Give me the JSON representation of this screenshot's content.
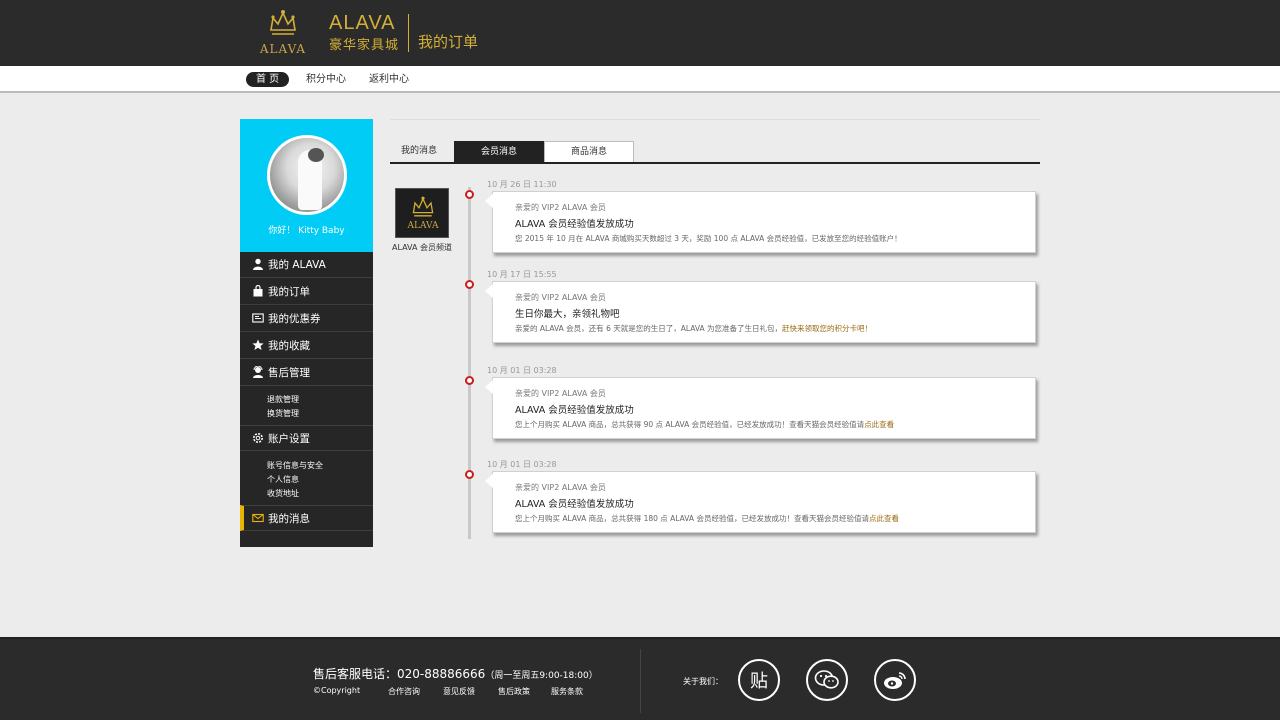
{
  "header": {
    "brand_emblem_text": "ALAVA",
    "brand_name": "ALAVA",
    "brand_subtitle": "豪华家具城",
    "page_heading": "我的订单"
  },
  "nav": {
    "items": [
      {
        "label": "首 页",
        "active": true
      },
      {
        "label": "积分中心",
        "active": false
      },
      {
        "label": "返利中心",
        "active": false
      }
    ]
  },
  "sidebar": {
    "greeting": "你好！ Kitty Baby",
    "menu": [
      {
        "icon": "user-icon",
        "label": "我的 ALAVA"
      },
      {
        "icon": "bag-icon",
        "label": "我的订单"
      },
      {
        "icon": "coupon-icon",
        "label": "我的优惠券"
      },
      {
        "icon": "star-icon",
        "label": "我的收藏"
      },
      {
        "icon": "service-icon",
        "label": "售后管理"
      },
      {
        "icon": "gear-icon",
        "label": "账户设置"
      },
      {
        "icon": "mail-icon",
        "label": "我的消息"
      }
    ],
    "after_sales_sub": [
      "退款管理",
      "换货管理"
    ],
    "account_sub": [
      "账号信息与安全",
      "个人信息",
      "收货地址"
    ]
  },
  "tabs": [
    {
      "label": "我的消息",
      "state": "plain"
    },
    {
      "label": "会员消息",
      "state": "active"
    },
    {
      "label": "商品消息",
      "state": "boxed"
    }
  ],
  "sender": {
    "logo_text": "ALAVA",
    "name": "ALAVA 会员频道"
  },
  "messages": [
    {
      "time": "10 月 26 日 11:30",
      "from": "亲爱的 VIP2 ALAVA 会员",
      "title": "ALAVA 会员经验值发放成功",
      "body": "您 2015 年 10 月在 ALAVA 商城购买天数超过 3 天，奖励 100 点 ALAVA 会员经验值，已发放至您的经验值账户！",
      "link": ""
    },
    {
      "time": "10 月 17 日 15:55",
      "from": "亲爱的 VIP2 ALAVA 会员",
      "title": "生日你最大，亲领礼物吧",
      "body": "亲爱的 ALAVA 会员，还有 6 天就是您的生日了，ALAVA 为您准备了生日礼包，",
      "link": "赶快来领取您的积分卡吧！"
    },
    {
      "time": "10 月 01 日 03:28",
      "from": "亲爱的 VIP2 ALAVA 会员",
      "title": "ALAVA 会员经验值发放成功",
      "body": "您上个月购买 ALAVA 商品，总共获得 90 点 ALAVA 会员经验值，已经发放成功！查看天猫会员经验值请",
      "link": "点此查看"
    },
    {
      "time": "10 月 01 日 03:28",
      "from": "亲爱的 VIP2 ALAVA 会员",
      "title": "ALAVA 会员经验值发放成功",
      "body": "您上个月购买 ALAVA 商品，总共获得 180 点 ALAVA 会员经验值，已经发放成功！查看天猫会员经验值请",
      "link": "点此查看"
    }
  ],
  "footer": {
    "hotline_label": "售后客服电话：020-88886666",
    "hotline_hours": "（周一至周五9:00-18:00）",
    "links": [
      "©Copyright",
      "合作咨询",
      "意见反馈",
      "售后政策",
      "服务条款"
    ],
    "follow_label": "关于我们：",
    "social": [
      {
        "icon": "tieba-icon",
        "glyph": "贴"
      },
      {
        "icon": "wechat-icon",
        "glyph": "◌"
      },
      {
        "icon": "weibo-icon",
        "glyph": "◎"
      }
    ]
  }
}
